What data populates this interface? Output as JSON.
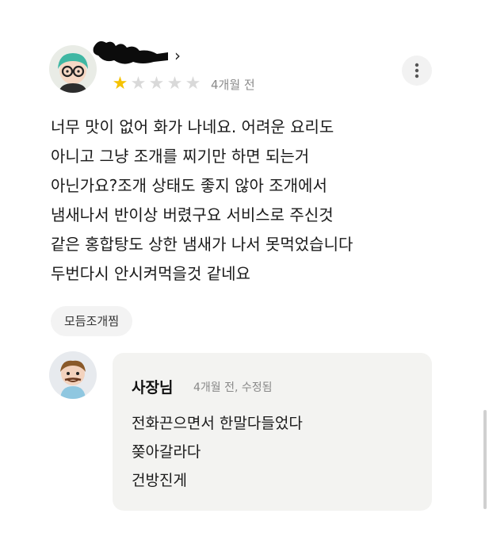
{
  "review": {
    "rating": 1,
    "rating_max": 5,
    "date": "4개월 전",
    "body": "너무 맛이 없어 화가 나네요. 어려운 요리도\n아니고 그냥  조개를 찌기만 하면 되는거\n아닌가요?조개 상태도 좋지 않아 조개에서\n냄새나서 반이상 버렸구요 서비스로 주신것\n같은 홍합탕도 상한 냄새가 나서 못먹었습니다\n두번다시 안시켜먹을것 같네요",
    "menu_tag": "모듬조개찜",
    "chevron": "›"
  },
  "reply": {
    "owner_name": "사장님",
    "meta": "4개월 전, 수정됨",
    "body": "전화끈으면서  한말다들었다\n쫒아갈라다\n건방진게"
  },
  "icons": {
    "reviewer_avatar": "character-avatar-icon",
    "owner_avatar": "character-avatar-icon",
    "more": "vertical-dots-icon",
    "star": "star-icon"
  },
  "colors": {
    "star_on": "#f5c200",
    "star_off": "#d9d9d9",
    "reply_bg": "#f3f3f1"
  }
}
